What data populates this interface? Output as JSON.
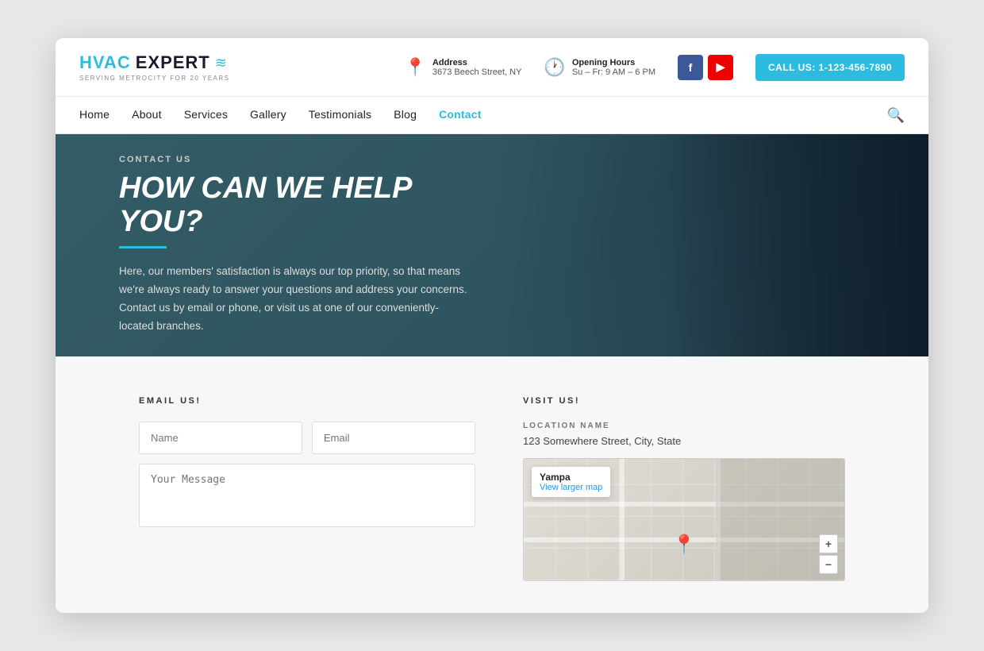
{
  "logo": {
    "hvac": "HVAC",
    "expert": "EXPERT",
    "subtitle": "SERVING METROCITY FOR 20 YEARS"
  },
  "header": {
    "address_label": "Address",
    "address_value": "3673 Beech Street, NY",
    "hours_label": "Opening Hours",
    "hours_value": "Su – Fr: 9 AM – 6 PM",
    "call_button": "CALL US: 1-123-456-7890"
  },
  "nav": {
    "items": [
      {
        "label": "Home",
        "active": false
      },
      {
        "label": "About",
        "active": false
      },
      {
        "label": "Services",
        "active": false
      },
      {
        "label": "Gallery",
        "active": false
      },
      {
        "label": "Testimonials",
        "active": false
      },
      {
        "label": "Blog",
        "active": false
      },
      {
        "label": "Contact",
        "active": true
      }
    ]
  },
  "hero": {
    "label": "CONTACT US",
    "title": "HOW CAN WE HELP YOU?",
    "description": "Here, our members' satisfaction is always our top priority, so that means we're always ready to answer your questions and address your concerns. Contact us by email or phone, or visit us at one of our conveniently-located branches."
  },
  "form": {
    "section_label": "EMAIL US!",
    "name_placeholder": "Name",
    "email_placeholder": "Email",
    "message_placeholder": "Your Message"
  },
  "map_section": {
    "section_label": "VISIT US!",
    "location_label": "LOCATION NAME",
    "address": "123 Somewhere Street, City, State",
    "map_popup_title": "Yampa",
    "map_popup_link": "View larger map",
    "zoom_in": "+",
    "zoom_out": "−"
  },
  "social": {
    "facebook": "f",
    "youtube": "▶"
  }
}
